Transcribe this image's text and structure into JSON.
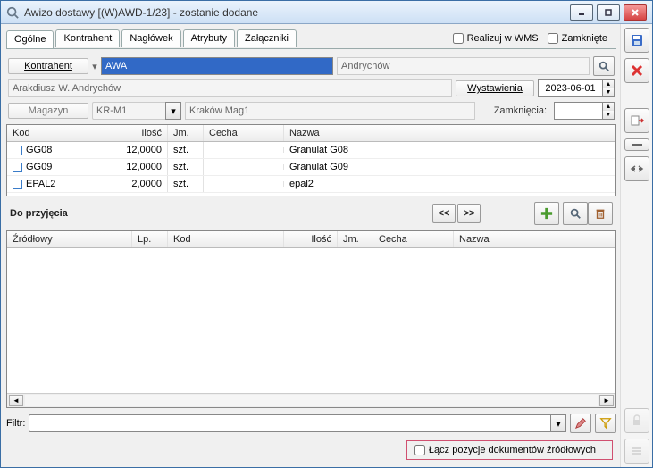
{
  "window": {
    "title": "Awizo dostawy [(W)AWD-1/23]  - zostanie dodane"
  },
  "tabs": {
    "t0": "Ogólne",
    "t1": "Kontrahent",
    "t2": "Nagłówek",
    "t3": "Atrybuty",
    "t4": "Załączniki"
  },
  "top_checks": {
    "wms": "Realizuj w WMS",
    "closed": "Zamknięte"
  },
  "form": {
    "kontrahent_label": "Kontrahent",
    "kontrahent_code": "AWA",
    "kontrahent_city": "Andrychów",
    "kontrahent_name": "Arakdiusz W. Andrychów",
    "wystawienia_label": "Wystawienia",
    "date": "2023-06-01",
    "magazyn_label": "Magazyn",
    "magazyn_code": "KR-M1",
    "magazyn_name": "Kraków Mag1",
    "zamkniecia_label": "Zamknięcia:",
    "zamkniecia_value": ""
  },
  "grid1": {
    "headers": {
      "kod": "Kod",
      "ilosc": "Ilość",
      "jm": "Jm.",
      "cecha": "Cecha",
      "nazwa": "Nazwa"
    },
    "rows": [
      {
        "kod": "GG08",
        "ilosc": "12,0000",
        "jm": "szt.",
        "cecha": "",
        "nazwa": "Granulat G08"
      },
      {
        "kod": "GG09",
        "ilosc": "12,0000",
        "jm": "szt.",
        "cecha": "",
        "nazwa": "Granulat G09"
      },
      {
        "kod": "EPAL2",
        "ilosc": "2,0000",
        "jm": "szt.",
        "cecha": "",
        "nazwa": "epal2"
      }
    ]
  },
  "section": {
    "title": "Do przyjęcia",
    "prev": "<<",
    "next": ">>"
  },
  "grid2": {
    "headers": {
      "zr": "Źródłowy",
      "lp": "Lp.",
      "kod": "Kod",
      "ilosc": "Ilość",
      "jm": "Jm.",
      "cecha": "Cecha",
      "nazwa": "Nazwa"
    }
  },
  "filter": {
    "label": "Filtr:",
    "value": ""
  },
  "merge": {
    "label": "Łącz pozycje dokumentów źródłowych"
  }
}
